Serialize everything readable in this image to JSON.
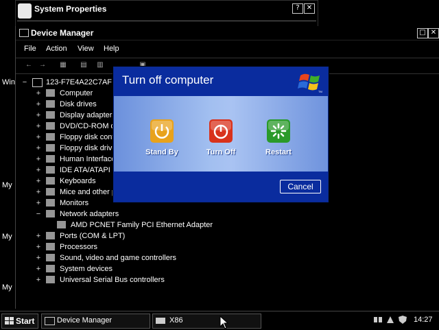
{
  "system_properties": {
    "title": "System Properties",
    "help_btn": "?",
    "close_btn": "✕"
  },
  "device_manager": {
    "title": "Device Manager",
    "menu": [
      "File",
      "Action",
      "View",
      "Help"
    ],
    "tree": {
      "root": "123-F7E4A22C7AF",
      "items": [
        {
          "label": "Computer",
          "exp": "+"
        },
        {
          "label": "Disk drives",
          "exp": "+"
        },
        {
          "label": "Display adapters",
          "exp": "+"
        },
        {
          "label": "DVD/CD-ROM dr",
          "exp": "+"
        },
        {
          "label": "Floppy disk contr",
          "exp": "+"
        },
        {
          "label": "Floppy disk drive",
          "exp": "+"
        },
        {
          "label": "Human Interface",
          "exp": "+"
        },
        {
          "label": "IDE ATA/ATAPI c",
          "exp": "+"
        },
        {
          "label": "Keyboards",
          "exp": "+"
        },
        {
          "label": "Mice and other p",
          "exp": "+"
        },
        {
          "label": "Monitors",
          "exp": "+"
        },
        {
          "label": "Network adapters",
          "exp": "−"
        },
        {
          "label": "AMD PCNET Family PCI Ethernet Adapter",
          "exp": "",
          "child": true
        },
        {
          "label": "Ports (COM & LPT)",
          "exp": "+"
        },
        {
          "label": "Processors",
          "exp": "+"
        },
        {
          "label": "Sound, video and game controllers",
          "exp": "+"
        },
        {
          "label": "System devices",
          "exp": "+"
        },
        {
          "label": "Universal Serial Bus controllers",
          "exp": "+"
        }
      ]
    }
  },
  "edge_labels": [
    "Win",
    "My",
    "My",
    "My"
  ],
  "dialog": {
    "title": "Turn off computer",
    "buttons": [
      {
        "label": "Stand By",
        "color": "#e8a21c"
      },
      {
        "label": "Turn Off",
        "color": "#d8321c"
      },
      {
        "label": "Restart",
        "color": "#2a9a2a"
      }
    ],
    "cancel": "Cancel"
  },
  "taskbar": {
    "start": "Start",
    "tasks": [
      "Device Manager",
      "X86"
    ],
    "clock": "14:27"
  }
}
